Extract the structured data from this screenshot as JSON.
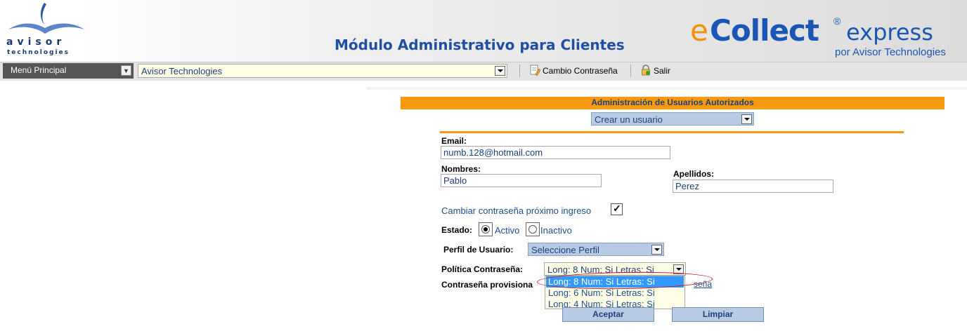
{
  "header": {
    "logo_word": "avisor",
    "logo_sub": "technologies",
    "app_title": "Módulo Administrativo para Clientes",
    "brand_e": "e",
    "brand_collect": "Collect",
    "brand_reg": "®",
    "brand_express": "express",
    "brand_sub": "por Avisor Technologies"
  },
  "toolbar": {
    "menu_label": "Menú Principal",
    "company_value": "Avisor Technologies",
    "change_password": "Cambio Contraseña",
    "logout": "Salir"
  },
  "panel": {
    "title": "Administración de Usuarios Autorizados",
    "action_value": "Crear un usuario"
  },
  "form": {
    "email_label": "Email:",
    "email_value": "numb.128@hotmail.com",
    "nombres_label": "Nombres:",
    "nombres_value": "Pablo",
    "apellidos_label": "Apellidos:",
    "apellidos_value": "Perez",
    "change_pw_label": "Cambiar contraseña próximo ingreso",
    "change_pw_checked": true,
    "estado_label": "Estado:",
    "estado_active": "Activo",
    "estado_inactive": "Inactivo",
    "estado_value": "Activo",
    "perfil_label": "Perfil de Usuario:",
    "perfil_value": "Seleccione Perfil",
    "policy_label": "Política Contraseña:",
    "policy_value": "Long: 8 Num: Si Letras: Si",
    "policy_options": [
      "Long: 8 Num: Si Letras: Si",
      "Long: 6 Num: Si Letras: Si",
      "Long: 4 Num: Si Letras: Si"
    ],
    "temp_pw_label": "Contraseña provisiona",
    "temp_pw_link_partial": "seña"
  },
  "buttons": {
    "accept": "Aceptar",
    "clear": "Limpiar"
  },
  "colors": {
    "accent_orange": "#f79a0f",
    "brand_blue": "#1a56b5",
    "selection_blue": "#3399ff",
    "annotation_red": "#d0131b"
  }
}
